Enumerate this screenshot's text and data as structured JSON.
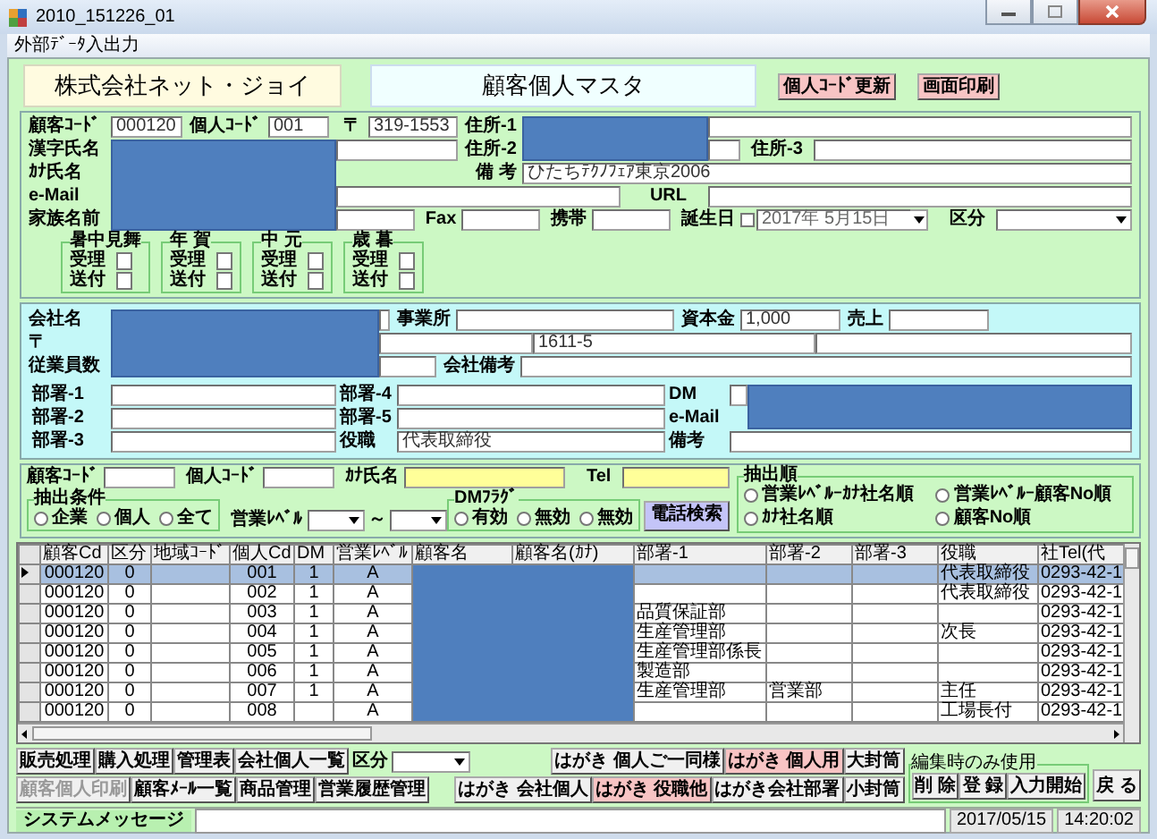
{
  "window": {
    "title": "2010_151226_01"
  },
  "menu": [
    {
      "label": "外部ﾃﾞｰﾀ入出力"
    }
  ],
  "header": {
    "company": "株式会社ネット・ジョイ",
    "title": "顧客個人マスタ",
    "buttons": [
      {
        "label": "個人ｺｰﾄﾞ更新",
        "kind": "accent"
      },
      {
        "label": "画面印刷",
        "kind": "accent"
      }
    ]
  },
  "person": {
    "customer_code": {
      "label": "顧客ｺｰﾄﾞ",
      "value": "000120"
    },
    "personal_code": {
      "label": "個人ｺｰﾄﾞ",
      "value": "001"
    },
    "postal": {
      "label": "〒",
      "value": "319-1553"
    },
    "address_1": {
      "label": "住所-1"
    },
    "address_2": {
      "label": "住所-2"
    },
    "address_3": {
      "label": "住所-3"
    },
    "kanji_name": {
      "label": "漢字氏名"
    },
    "kana_name": {
      "label": "ｶﾅ氏名"
    },
    "note": {
      "label": "備 考",
      "value": "ひたちﾃｸﾉﾌｪｱ東京2006"
    },
    "email": {
      "label": "e-Mail"
    },
    "url": {
      "label": "URL"
    },
    "family_name": {
      "label": "家族名前"
    },
    "fax": {
      "label": "Fax"
    },
    "mobile": {
      "label": "携帯"
    },
    "birthday": {
      "label": "誕生日",
      "value": "2017年 5月15日",
      "checked": false
    },
    "category": {
      "label": "区分"
    },
    "greetings": [
      {
        "title": "暑中見舞",
        "rows": [
          {
            "label": "受理",
            "checked": false
          },
          {
            "label": "送付",
            "checked": false
          }
        ]
      },
      {
        "title": "年 賀",
        "rows": [
          {
            "label": "受理",
            "checked": false
          },
          {
            "label": "送付",
            "checked": false
          }
        ]
      },
      {
        "title": "中 元",
        "rows": [
          {
            "label": "受理",
            "checked": false
          },
          {
            "label": "送付",
            "checked": false
          }
        ]
      },
      {
        "title": "歳 暮",
        "rows": [
          {
            "label": "受理",
            "checked": false
          },
          {
            "label": "送付",
            "checked": false
          }
        ]
      }
    ]
  },
  "company": {
    "name": {
      "label": "会社名"
    },
    "office": {
      "label": "事業所"
    },
    "capital": {
      "label": "資本金",
      "value": "1,000"
    },
    "sales": {
      "label": "売上"
    },
    "postal": {
      "label": "〒"
    },
    "address": {
      "value": "1611-5"
    },
    "employees": {
      "label": "従業員数"
    },
    "note": {
      "label": "会社備考"
    },
    "departments": [
      {
        "label": "部署-1"
      },
      {
        "label": "部署-4"
      },
      {
        "label": "部署-2"
      },
      {
        "label": "部署-5"
      },
      {
        "label": "部署-3"
      }
    ],
    "position": {
      "label": "役職",
      "value": "代表取締役"
    },
    "dm": {
      "label": "DM"
    },
    "email": {
      "label": "e-Mail"
    },
    "remarks": {
      "label": "備考"
    }
  },
  "search": {
    "customer_code": {
      "label": "顧客ｺｰﾄﾞ"
    },
    "personal_code": {
      "label": "個人ｺｰﾄﾞ"
    },
    "kana_name": {
      "label": "ｶﾅ氏名"
    },
    "tel": {
      "label": "Tel"
    },
    "condition": {
      "title": "抽出条件",
      "options": [
        {
          "label": "企業",
          "selected": false
        },
        {
          "label": "個人",
          "selected": false
        },
        {
          "label": "全て",
          "selected": false
        }
      ]
    },
    "sales_level": {
      "label": "営業ﾚﾍﾞﾙ",
      "separator": "～"
    },
    "dm_flag": {
      "title": "DMﾌﾗｸﾞ",
      "options": [
        {
          "label": "有効",
          "selected": false
        },
        {
          "label": "無効",
          "selected": false
        },
        {
          "label": "無効",
          "selected": false
        }
      ]
    },
    "button": {
      "label": "電話検索",
      "kind": "search"
    },
    "order": {
      "title": "抽出順",
      "options": [
        {
          "label": "営業ﾚﾍﾞﾙｰｶﾅ社名順",
          "selected": false
        },
        {
          "label": "営業ﾚﾍﾞﾙｰ顧客No順",
          "selected": false
        },
        {
          "label": "ｶﾅ社名順",
          "selected": false
        },
        {
          "label": "顧客No順",
          "selected": false
        }
      ]
    }
  },
  "table": {
    "columns": [
      {
        "label": "顧客Cd",
        "redacted": false
      },
      {
        "label": "区分",
        "redacted": false
      },
      {
        "label": "地域ｺｰﾄﾞ",
        "redacted": false
      },
      {
        "label": "個人Cd",
        "redacted": false
      },
      {
        "label": "DM",
        "redacted": false
      },
      {
        "label": "営業ﾚﾍﾞﾙ",
        "redacted": false
      },
      {
        "label": "顧客名",
        "redacted": true
      },
      {
        "label": "顧客名(ｶﾅ)",
        "redacted": true
      },
      {
        "label": "部署-1",
        "redacted": false
      },
      {
        "label": "部署-2",
        "redacted": false
      },
      {
        "label": "部署-3",
        "redacted": false
      },
      {
        "label": "役職",
        "redacted": false
      },
      {
        "label": "社Tel(代",
        "redacted": false
      }
    ],
    "rows": [
      {
        "selected": true,
        "cells": [
          "000120",
          "0",
          null,
          "001",
          "1",
          "A",
          null,
          null,
          null,
          null,
          null,
          "代表取締役",
          "0293-42-1"
        ]
      },
      {
        "selected": false,
        "cells": [
          "000120",
          "0",
          null,
          "002",
          "1",
          "A",
          null,
          null,
          null,
          null,
          null,
          "代表取締役",
          "0293-42-1"
        ]
      },
      {
        "selected": false,
        "cells": [
          "000120",
          "0",
          null,
          "003",
          "1",
          "A",
          null,
          null,
          "品質保証部",
          null,
          null,
          null,
          "0293-42-1"
        ]
      },
      {
        "selected": false,
        "cells": [
          "000120",
          "0",
          null,
          "004",
          "1",
          "A",
          null,
          null,
          "生産管理部",
          null,
          null,
          "次長",
          "0293-42-1"
        ]
      },
      {
        "selected": false,
        "cells": [
          "000120",
          "0",
          null,
          "005",
          "1",
          "A",
          null,
          null,
          "生産管理部係長",
          null,
          null,
          null,
          "0293-42-1"
        ]
      },
      {
        "selected": false,
        "cells": [
          "000120",
          "0",
          null,
          "006",
          "1",
          "A",
          null,
          null,
          "製造部",
          null,
          null,
          null,
          "0293-42-1"
        ]
      },
      {
        "selected": false,
        "cells": [
          "000120",
          "0",
          null,
          "007",
          "1",
          "A",
          null,
          null,
          "生産管理部",
          "営業部",
          null,
          "主任",
          "0293-42-1"
        ]
      },
      {
        "selected": false,
        "cells": [
          "000120",
          "0",
          null,
          "008",
          null,
          "A",
          null,
          null,
          null,
          null,
          null,
          "工場長付",
          "0293-42-1"
        ]
      }
    ]
  },
  "actions": {
    "main": [
      {
        "label": "販売処理",
        "disabled": false
      },
      {
        "label": "購入処理",
        "disabled": false
      },
      {
        "label": "管理表",
        "disabled": false
      },
      {
        "label": "会社個人一覧",
        "disabled": false
      },
      {
        "label": "顧客個人印刷",
        "disabled": true
      },
      {
        "label": "顧客ﾒｰﾙ一覧",
        "disabled": false
      },
      {
        "label": "商品管理",
        "disabled": false
      },
      {
        "label": "営業履歴管理",
        "disabled": false
      }
    ],
    "category": {
      "label": "区分"
    },
    "postcards_top": [
      {
        "label": "はがき 個人ご一同様",
        "kind": "normal"
      },
      {
        "label": "はがき 個人用",
        "kind": "accent"
      },
      {
        "label": "大封筒",
        "kind": "normal"
      }
    ],
    "postcards_bottom": [
      {
        "label": "はがき 会社個人",
        "kind": "normal"
      },
      {
        "label": "はがき 役職他",
        "kind": "accent"
      },
      {
        "label": "はがき会社部署",
        "kind": "normal"
      },
      {
        "label": "小封筒",
        "kind": "normal"
      }
    ],
    "edit_group": {
      "title": "編集時のみ使用",
      "buttons": [
        {
          "label": "削 除"
        },
        {
          "label": "登 録"
        },
        {
          "label": "入力開始"
        }
      ]
    },
    "back": {
      "label": "戻 る"
    }
  },
  "status_bar": {
    "label": "システムメッセージ",
    "date": "2017/05/15",
    "time": "14:20:02"
  }
}
